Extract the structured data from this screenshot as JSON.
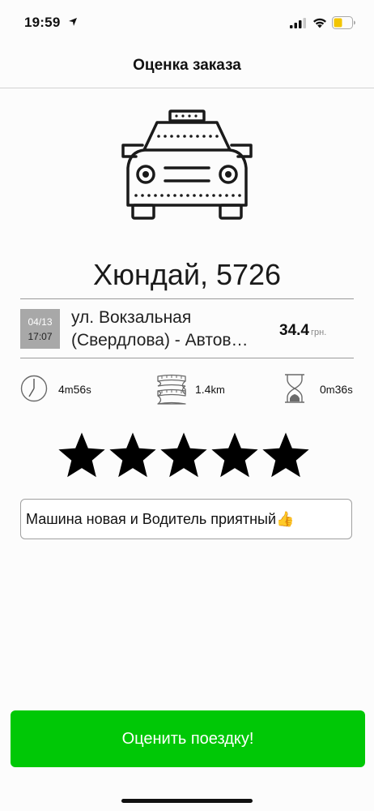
{
  "status_bar": {
    "time": "19:59"
  },
  "nav": {
    "title": "Оценка заказа"
  },
  "order": {
    "car": "Хюндай, 5726",
    "date": "04/13",
    "time": "17:07",
    "address_line1": "ул. Вокзальная",
    "address_line2": "(Свердлова) - Автов…",
    "price": "34.4",
    "currency": "грн."
  },
  "stats": {
    "duration": {
      "minutes": "4",
      "m_unit": "m",
      "seconds": "56",
      "s_unit": "s"
    },
    "distance": {
      "value": "1.4",
      "unit": "km"
    },
    "waiting": {
      "minutes": "0",
      "m_unit": "m",
      "seconds": "36",
      "s_unit": "s"
    }
  },
  "rating": {
    "stars": 5,
    "max": 5
  },
  "comment": {
    "value": "Машина новая и Водитель приятный👍"
  },
  "submit": {
    "label": "Оценить поездку!"
  },
  "colors": {
    "accent": "#00c806",
    "date_box": "#a8a8a8"
  },
  "icons": [
    "location-arrow-icon",
    "signal-icon",
    "wifi-icon",
    "battery-icon",
    "taxi-car-icon",
    "clock-icon",
    "tape-measure-icon",
    "hourglass-icon",
    "star-icon"
  ]
}
